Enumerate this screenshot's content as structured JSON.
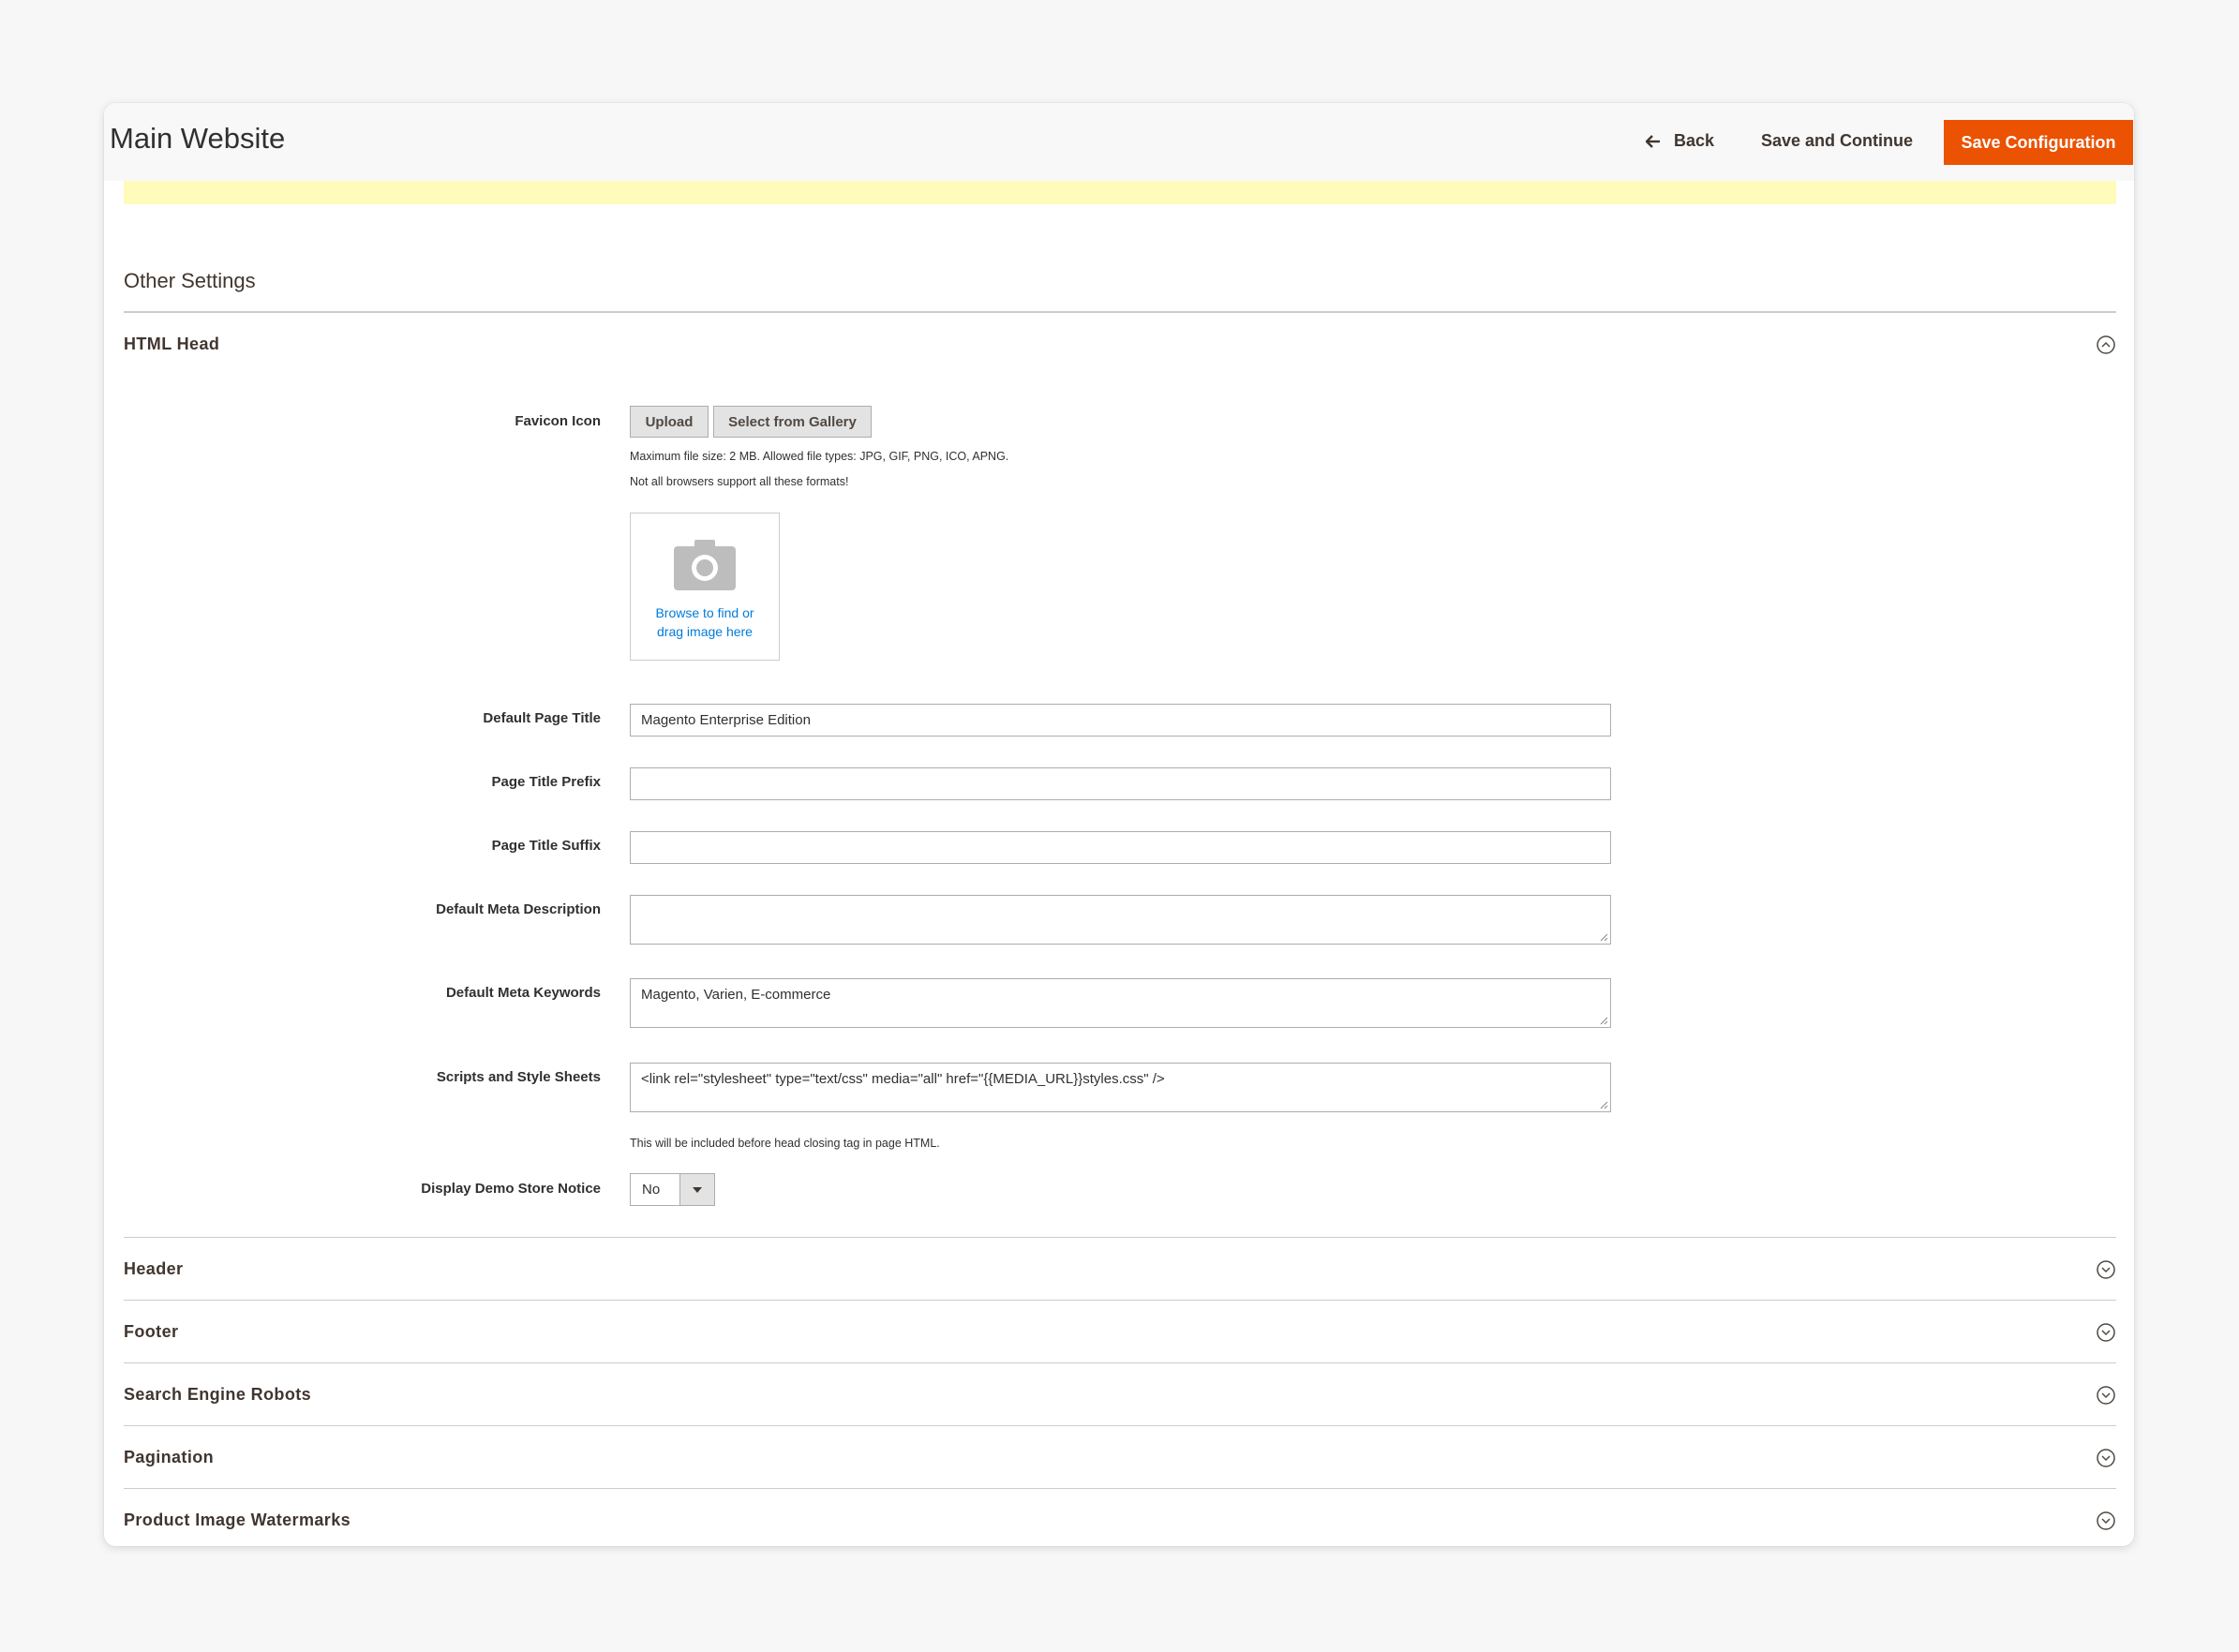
{
  "header": {
    "title": "Main Website",
    "back_label": "Back",
    "save_continue_label": "Save and Continue",
    "save_config_label": "Save Configuration"
  },
  "colors": {
    "primary_button": "#eb5202",
    "notice_background": "#fffbbb",
    "link": "#007bdb"
  },
  "section": {
    "title": "Other Settings"
  },
  "html_head": {
    "title": "HTML Head",
    "expanded": true,
    "favicon": {
      "label": "Favicon Icon",
      "upload_label": "Upload",
      "gallery_label": "Select from Gallery",
      "note_1": "Maximum file size: 2 MB. Allowed file types: JPG, GIF, PNG, ICO, APNG.",
      "note_2": "Not all browsers support all these formats!",
      "dropzone_line_1": "Browse to find or",
      "dropzone_line_2": "drag image here"
    },
    "default_page_title": {
      "label": "Default Page Title",
      "value": "Magento Enterprise Edition"
    },
    "page_title_prefix": {
      "label": "Page Title Prefix",
      "value": ""
    },
    "page_title_suffix": {
      "label": "Page Title Suffix",
      "value": ""
    },
    "default_meta_description": {
      "label": "Default Meta Description",
      "value": ""
    },
    "default_meta_keywords": {
      "label": "Default Meta Keywords",
      "value": "Magento, Varien, E-commerce"
    },
    "scripts_styles": {
      "label": "Scripts and Style Sheets",
      "value": "<link  rel=\"stylesheet\" type=\"text/css\"  media=\"all\" href=\"{{MEDIA_URL}}styles.css\" />",
      "note": "This will be included before head closing tag in page HTML."
    },
    "demo_notice": {
      "label": "Display Demo Store Notice",
      "value": "No"
    }
  },
  "groups": [
    {
      "title": "Header",
      "expanded": false
    },
    {
      "title": "Footer",
      "expanded": false
    },
    {
      "title": "Search Engine Robots",
      "expanded": false
    },
    {
      "title": "Pagination",
      "expanded": false
    },
    {
      "title": "Product Image Watermarks",
      "expanded": false
    }
  ]
}
